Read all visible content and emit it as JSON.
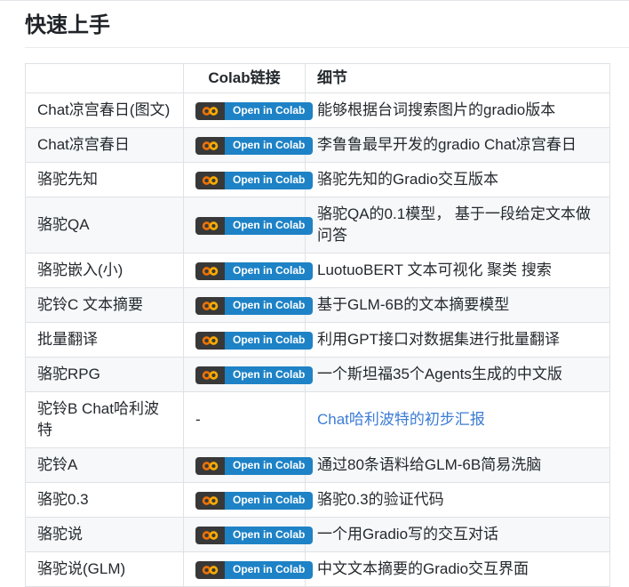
{
  "title": "快速上手",
  "colors": {
    "link_blue": "#3b7cd5",
    "badge_dark": "#383838",
    "badge_blue": "#1e82c6",
    "logo_orange_dark": "#e8710a",
    "logo_orange_light": "#f9ab00",
    "alt_row_bg": "#f6f8fa",
    "table_border": "#dfe2e5"
  },
  "table": {
    "headers": [
      "",
      "Colab链接",
      "细节"
    ],
    "badge_label": "Open in Colab",
    "dash": "-",
    "rows": [
      {
        "name": "Chat凉宫春日(图文)",
        "colab": "badge",
        "detail": "能够根据台词搜索图片的gradio版本",
        "detail_is_link": false
      },
      {
        "name": "Chat凉宫春日",
        "colab": "badge",
        "detail": "李鲁鲁最早开发的gradio Chat凉宫春日",
        "detail_is_link": false
      },
      {
        "name": "骆驼先知",
        "colab": "badge",
        "detail": "骆驼先知的Gradio交互版本",
        "detail_is_link": false
      },
      {
        "name": "骆驼QA",
        "colab": "badge",
        "detail": "骆驼QA的0.1模型， 基于一段给定文本做问答",
        "detail_is_link": false
      },
      {
        "name": "骆驼嵌入(小)",
        "colab": "badge",
        "detail": "LuotuoBERT 文本可视化 聚类 搜索",
        "detail_is_link": false
      },
      {
        "name": "驼铃C 文本摘要",
        "colab": "badge",
        "detail": "基于GLM-6B的文本摘要模型",
        "detail_is_link": false
      },
      {
        "name": "批量翻译",
        "colab": "badge",
        "detail": "利用GPT接口对数据集进行批量翻译",
        "detail_is_link": false
      },
      {
        "name": "骆驼RPG",
        "colab": "badge",
        "detail": "一个斯坦福35个Agents生成的中文版",
        "detail_is_link": false
      },
      {
        "name": "驼铃B Chat哈利波特",
        "colab": "dash",
        "detail": "Chat哈利波特的初步汇报",
        "detail_is_link": true
      },
      {
        "name": "驼铃A",
        "colab": "badge",
        "detail": "通过80条语料给GLM-6B简易洗脑",
        "detail_is_link": false
      },
      {
        "name": "骆驼0.3",
        "colab": "badge",
        "detail": "骆驼0.3的验证代码",
        "detail_is_link": false
      },
      {
        "name": "骆驼说",
        "colab": "badge",
        "detail": "一个用Gradio写的交互对话",
        "detail_is_link": false
      },
      {
        "name": "骆驼说(GLM)",
        "colab": "badge",
        "detail": "中文文本摘要的Gradio交互界面",
        "detail_is_link": false
      }
    ]
  }
}
